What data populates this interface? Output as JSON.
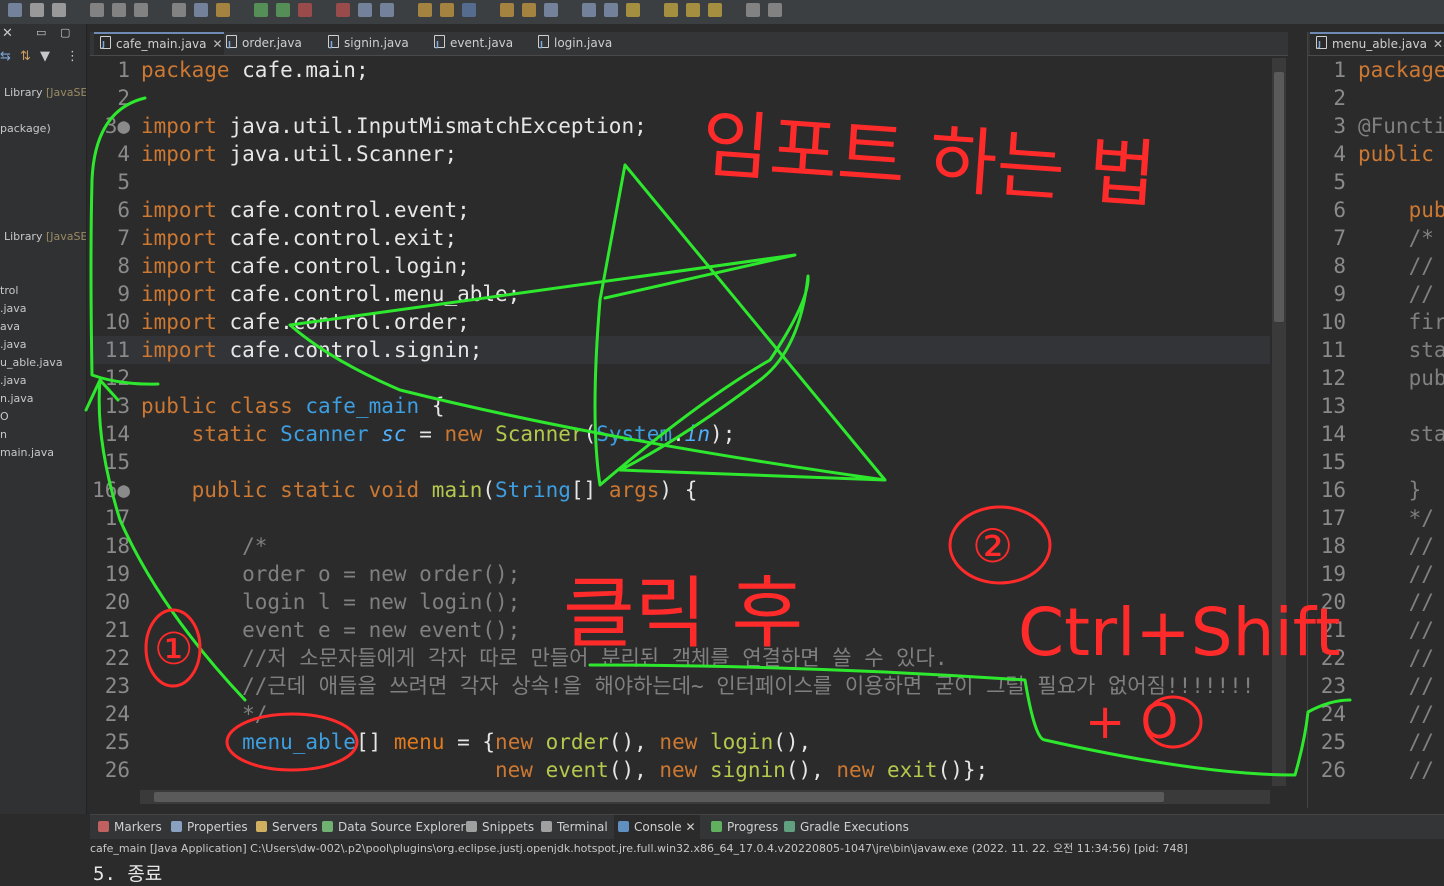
{
  "editor_tabs": [
    {
      "label": "cafe_main.java",
      "active": true,
      "closable": true
    },
    {
      "label": "order.java",
      "active": false,
      "closable": false
    },
    {
      "label": "signin.java",
      "active": false,
      "closable": false
    },
    {
      "label": "event.java",
      "active": false,
      "closable": false
    },
    {
      "label": "login.java",
      "active": false,
      "closable": false
    }
  ],
  "right_tab": {
    "label": "menu_able.java",
    "close": "✕"
  },
  "left_panel": {
    "items": [
      "Library",
      "[JavaSE",
      "package)",
      "Library",
      "[JavaSE",
      "trol",
      ".java",
      "ava",
      ".java",
      "u_able.java",
      ".java",
      "n.java",
      "O",
      "n",
      "main.java"
    ]
  },
  "code_lines": [
    {
      "n": "1",
      "tokens": [
        [
          "kw",
          "package "
        ],
        [
          "pl",
          "cafe.main;"
        ]
      ]
    },
    {
      "n": "2",
      "tokens": []
    },
    {
      "n": "3●",
      "tokens": [
        [
          "kw",
          "import "
        ],
        [
          "pl",
          "java.util.InputMismatchException;"
        ]
      ]
    },
    {
      "n": "4",
      "tokens": [
        [
          "kw",
          "import "
        ],
        [
          "pl",
          "java.util.Scanner;"
        ]
      ]
    },
    {
      "n": "5",
      "tokens": []
    },
    {
      "n": "6",
      "tokens": [
        [
          "kw",
          "import "
        ],
        [
          "pl",
          "cafe.control.event;"
        ]
      ]
    },
    {
      "n": "7",
      "tokens": [
        [
          "kw",
          "import "
        ],
        [
          "pl",
          "cafe.control.exit;"
        ]
      ]
    },
    {
      "n": "8",
      "tokens": [
        [
          "kw",
          "import "
        ],
        [
          "pl",
          "cafe.control.login;"
        ]
      ]
    },
    {
      "n": "9",
      "tokens": [
        [
          "kw",
          "import "
        ],
        [
          "pl",
          "cafe.control.menu_able;"
        ]
      ]
    },
    {
      "n": "10",
      "tokens": [
        [
          "kw",
          "import "
        ],
        [
          "pl",
          "cafe.control.order;"
        ]
      ]
    },
    {
      "n": "11",
      "tokens": [
        [
          "kw",
          "import "
        ],
        [
          "pl",
          "cafe.control.signin;"
        ]
      ],
      "highlight": true
    },
    {
      "n": "12",
      "tokens": []
    },
    {
      "n": "13",
      "tokens": [
        [
          "kw",
          "public class "
        ],
        [
          "ty",
          "cafe_main"
        ],
        [
          "pl",
          " {"
        ]
      ]
    },
    {
      "n": "14",
      "tokens": [
        [
          "pl",
          "    "
        ],
        [
          "kw",
          "static "
        ],
        [
          "ty",
          "Scanner "
        ],
        [
          "fd",
          "sc"
        ],
        [
          "pl",
          " = "
        ],
        [
          "kw",
          "new "
        ],
        [
          "fn",
          "Scanner"
        ],
        [
          "pl",
          "("
        ],
        [
          "ty",
          "System"
        ],
        [
          "pl",
          "."
        ],
        [
          "fd",
          "in"
        ],
        [
          "pl",
          ");"
        ]
      ]
    },
    {
      "n": "15",
      "tokens": []
    },
    {
      "n": "16●",
      "tokens": [
        [
          "pl",
          "    "
        ],
        [
          "kw",
          "public static void "
        ],
        [
          "fn",
          "main"
        ],
        [
          "pl",
          "("
        ],
        [
          "ty",
          "String"
        ],
        [
          "pl",
          "[] "
        ],
        [
          "kw",
          "args"
        ],
        [
          "pl",
          ") {"
        ]
      ]
    },
    {
      "n": "17",
      "tokens": []
    },
    {
      "n": "18",
      "tokens": [
        [
          "cm",
          "        /*"
        ]
      ]
    },
    {
      "n": "19",
      "tokens": [
        [
          "cm",
          "        order o = new order();"
        ]
      ]
    },
    {
      "n": "20",
      "tokens": [
        [
          "cm",
          "        login l = new login();"
        ]
      ]
    },
    {
      "n": "21",
      "tokens": [
        [
          "cm",
          "        event e = new event();"
        ]
      ]
    },
    {
      "n": "22",
      "tokens": [
        [
          "cm",
          "        //저 소문자들에게 각자 따로 만들어 분리된 객체를 연결하면 쓸 수 있다."
        ]
      ]
    },
    {
      "n": "23",
      "tokens": [
        [
          "cm",
          "        //근데 애들을 쓰려면 각자 상속!을 해야하는데~ 인터페이스를 이용하면 굳이 그럴 필요가 없어짐!!!!!!!"
        ]
      ]
    },
    {
      "n": "24",
      "tokens": [
        [
          "cm",
          "        */"
        ]
      ]
    },
    {
      "n": "25",
      "tokens": [
        [
          "pl",
          "        "
        ],
        [
          "ty",
          "menu_able"
        ],
        [
          "pl",
          "[] "
        ],
        [
          "kwc",
          "menu"
        ],
        [
          "pl",
          " = {"
        ],
        [
          "kw",
          "new "
        ],
        [
          "fn",
          "order"
        ],
        [
          "pl",
          "(), "
        ],
        [
          "kw",
          "new "
        ],
        [
          "fn",
          "login"
        ],
        [
          "pl",
          "(),"
        ]
      ]
    },
    {
      "n": "26",
      "tokens": [
        [
          "pl",
          "                            "
        ],
        [
          "kw",
          "new "
        ],
        [
          "fn",
          "event"
        ],
        [
          "pl",
          "(), "
        ],
        [
          "kw",
          "new "
        ],
        [
          "fn",
          "signin"
        ],
        [
          "pl",
          "(), "
        ],
        [
          "kw",
          "new "
        ],
        [
          "fn",
          "exit"
        ],
        [
          "pl",
          "()};"
        ]
      ]
    }
  ],
  "right_code_lines": [
    {
      "n": "1",
      "text": "package",
      "cls": "kw"
    },
    {
      "n": "2",
      "text": "",
      "cls": "pl"
    },
    {
      "n": "3",
      "text": "@Functi",
      "cls": "cm"
    },
    {
      "n": "4",
      "text": "public",
      "cls": "kw"
    },
    {
      "n": "5",
      "text": "",
      "cls": "pl"
    },
    {
      "n": "6",
      "text": "    pub",
      "cls": "kw"
    },
    {
      "n": "7",
      "text": "    /*",
      "cls": "cm"
    },
    {
      "n": "8",
      "text": "    //",
      "cls": "cm"
    },
    {
      "n": "9",
      "text": "    //",
      "cls": "cm"
    },
    {
      "n": "10",
      "text": "    fir",
      "cls": "cm"
    },
    {
      "n": "11",
      "text": "    sta",
      "cls": "cm"
    },
    {
      "n": "12",
      "text": "    pub",
      "cls": "cm"
    },
    {
      "n": "13",
      "text": "",
      "cls": "pl"
    },
    {
      "n": "14",
      "text": "    sta",
      "cls": "cm"
    },
    {
      "n": "15",
      "text": "",
      "cls": "pl"
    },
    {
      "n": "16",
      "text": "    }",
      "cls": "cm"
    },
    {
      "n": "17",
      "text": "    */",
      "cls": "cm"
    },
    {
      "n": "18",
      "text": "    //",
      "cls": "cm"
    },
    {
      "n": "19",
      "text": "    //",
      "cls": "cm"
    },
    {
      "n": "20",
      "text": "    //",
      "cls": "cm"
    },
    {
      "n": "21",
      "text": "    //",
      "cls": "cm"
    },
    {
      "n": "22",
      "text": "    //",
      "cls": "cm"
    },
    {
      "n": "23",
      "text": "    //",
      "cls": "cm"
    },
    {
      "n": "24",
      "text": "    //",
      "cls": "cm"
    },
    {
      "n": "25",
      "text": "    //",
      "cls": "cm"
    },
    {
      "n": "26",
      "text": "    //",
      "cls": "cm"
    }
  ],
  "bottom_tabs": [
    {
      "label": "Markers",
      "icon": "markers-icon",
      "color": "#c06060"
    },
    {
      "label": "Properties",
      "icon": "properties-icon",
      "color": "#8aa0c0"
    },
    {
      "label": "Servers",
      "icon": "servers-icon",
      "color": "#d0b060"
    },
    {
      "label": "Data Source Explorer",
      "icon": "data-source-icon",
      "color": "#70b070"
    },
    {
      "label": "Snippets",
      "icon": "snippets-icon",
      "color": "#a0a0a0"
    },
    {
      "label": "Terminal",
      "icon": "terminal-icon",
      "color": "#a0a0a0"
    },
    {
      "label": "Console",
      "icon": "console-icon",
      "color": "#6090c0",
      "active": true
    },
    {
      "label": "Progress",
      "icon": "progress-icon",
      "color": "#60b060"
    },
    {
      "label": "Gradle Executions",
      "icon": "gradle-icon",
      "color": "#60a080"
    }
  ],
  "console": {
    "description": "cafe_main [Java Application] C:\\Users\\dw-002\\.p2\\pool\\plugins\\org.eclipse.justj.openjdk.hotspot.jre.full.win32.x86_64_17.0.4.v20220805-1047\\jre\\bin\\javaw.exe  (2022. 11. 22. 오전 11:34:56) [pid: 748]",
    "output": "5. 종료"
  },
  "annotations": {
    "red_title": "임포트 하는 법",
    "step1": "①",
    "click_after": "클릭 후",
    "step2": "②",
    "shortcut_line1": "Ctrl+Shift",
    "shortcut_line2": "+ O",
    "red": "#ff2a2a",
    "green": "#2ee82e"
  }
}
